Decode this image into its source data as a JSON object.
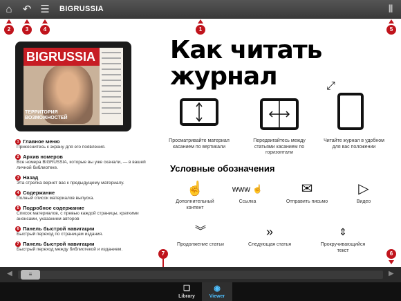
{
  "topbar": {
    "title": "BIGRUSSIA",
    "icons": [
      "home-icon",
      "back-arrow-icon",
      "list-icon",
      "library-icon"
    ]
  },
  "badges": [
    "1",
    "2",
    "3",
    "4",
    "5",
    "6",
    "7"
  ],
  "cover": {
    "masthead": "BIGRUSSIA",
    "headline": "ТЕРРИТОРИЯ ВОЗМОЖНОСТЕЙ"
  },
  "legend": [
    {
      "num": "1",
      "title": "Главное меню",
      "desc": "Прикоснитесь к экрану для его появления."
    },
    {
      "num": "2",
      "title": "Архив номеров",
      "desc": "Все номера BIGRUSSIA, которые вы уже скачали, — в вашей личной библиотеке."
    },
    {
      "num": "3",
      "title": "Назад",
      "desc": "Эта стрелка вернет вас к предыдущему материалу."
    },
    {
      "num": "4",
      "title": "Содержание",
      "desc": "Полный список материалов выпуска."
    },
    {
      "num": "5",
      "title": "Подробное содержание",
      "desc": "Список материалов, с превью каждой страницы, краткими анонсами, указанием авторов"
    },
    {
      "num": "6",
      "title": "Панель быстрой навигации",
      "desc": "Быстрый переход по страницам издания."
    },
    {
      "num": "7",
      "title": "Панель быстрой навигации",
      "desc": "Быстрый переход между библиотекой и изданием."
    }
  ],
  "heading": {
    "line1": "Как читать",
    "line2": "журнал"
  },
  "instructions": [
    "Просматривайте материал касанием по вертикали",
    "Передвигайтесь между статьями касанием по горизонтали",
    "Читайте журнал в удобном для вас положении"
  ],
  "conventions": {
    "title": "Условные обозначения",
    "items": [
      {
        "label": "Дополнительный контент",
        "icon": "tap-icon"
      },
      {
        "label": "Ссылка",
        "icon": "link-www-icon",
        "glyph": "www"
      },
      {
        "label": "Отправить письмо",
        "icon": "mail-icon"
      },
      {
        "label": "Видео",
        "icon": "play-icon"
      },
      {
        "label": "Продолжение статьи",
        "icon": "chevron-down-double-icon"
      },
      {
        "label": "Следующая статья",
        "icon": "chevron-right-double-icon"
      },
      {
        "label": "Прокручивающийся текст",
        "icon": "scroll-updown-icon"
      }
    ]
  },
  "tabs": [
    {
      "label": "Library",
      "icon": "library-icon",
      "active": false
    },
    {
      "label": "Viewer",
      "icon": "eye-icon",
      "active": true
    }
  ],
  "colors": {
    "accent": "#c0141c",
    "active_tab": "#4fc0ff"
  }
}
